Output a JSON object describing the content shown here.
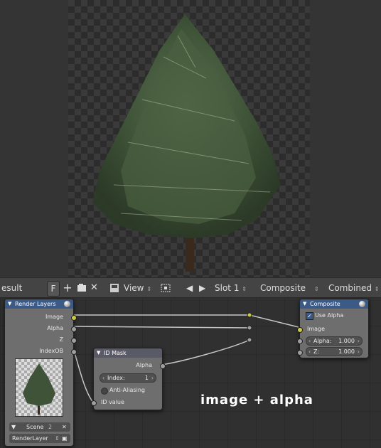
{
  "toolbar": {
    "image_name": "esult",
    "fake_user": "F",
    "add_icon": "+",
    "close_icon": "✕",
    "view_label": "View",
    "slot_label": "Slot 1",
    "layer_label": "Composite",
    "pass_label": "Combined"
  },
  "nodes": {
    "render_layers": {
      "title": "Render Layers",
      "outputs": [
        "Image",
        "Alpha",
        "Z",
        "IndexOB"
      ],
      "scene_label": "Scene",
      "scene_users": "2",
      "layer_value": "RenderLayer"
    },
    "id_mask": {
      "title": "ID Mask",
      "output": "Alpha",
      "index_label": "Index:",
      "index_value": "1",
      "antialias_label": "Anti-Aliasing",
      "input": "ID value"
    },
    "composite": {
      "title": "Composite",
      "use_alpha_label": "Use Alpha",
      "input_image": "Image",
      "alpha_label": "Alpha:",
      "alpha_value": "1.000",
      "z_label": "Z:",
      "z_value": "1.000"
    }
  },
  "annotation": "image + alpha",
  "colors": {
    "node_header_blue": "#3b5a86",
    "node_header_gray": "#5a5a66",
    "socket_yellow": "#cccc44",
    "socket_gray": "#a0a0a0"
  }
}
